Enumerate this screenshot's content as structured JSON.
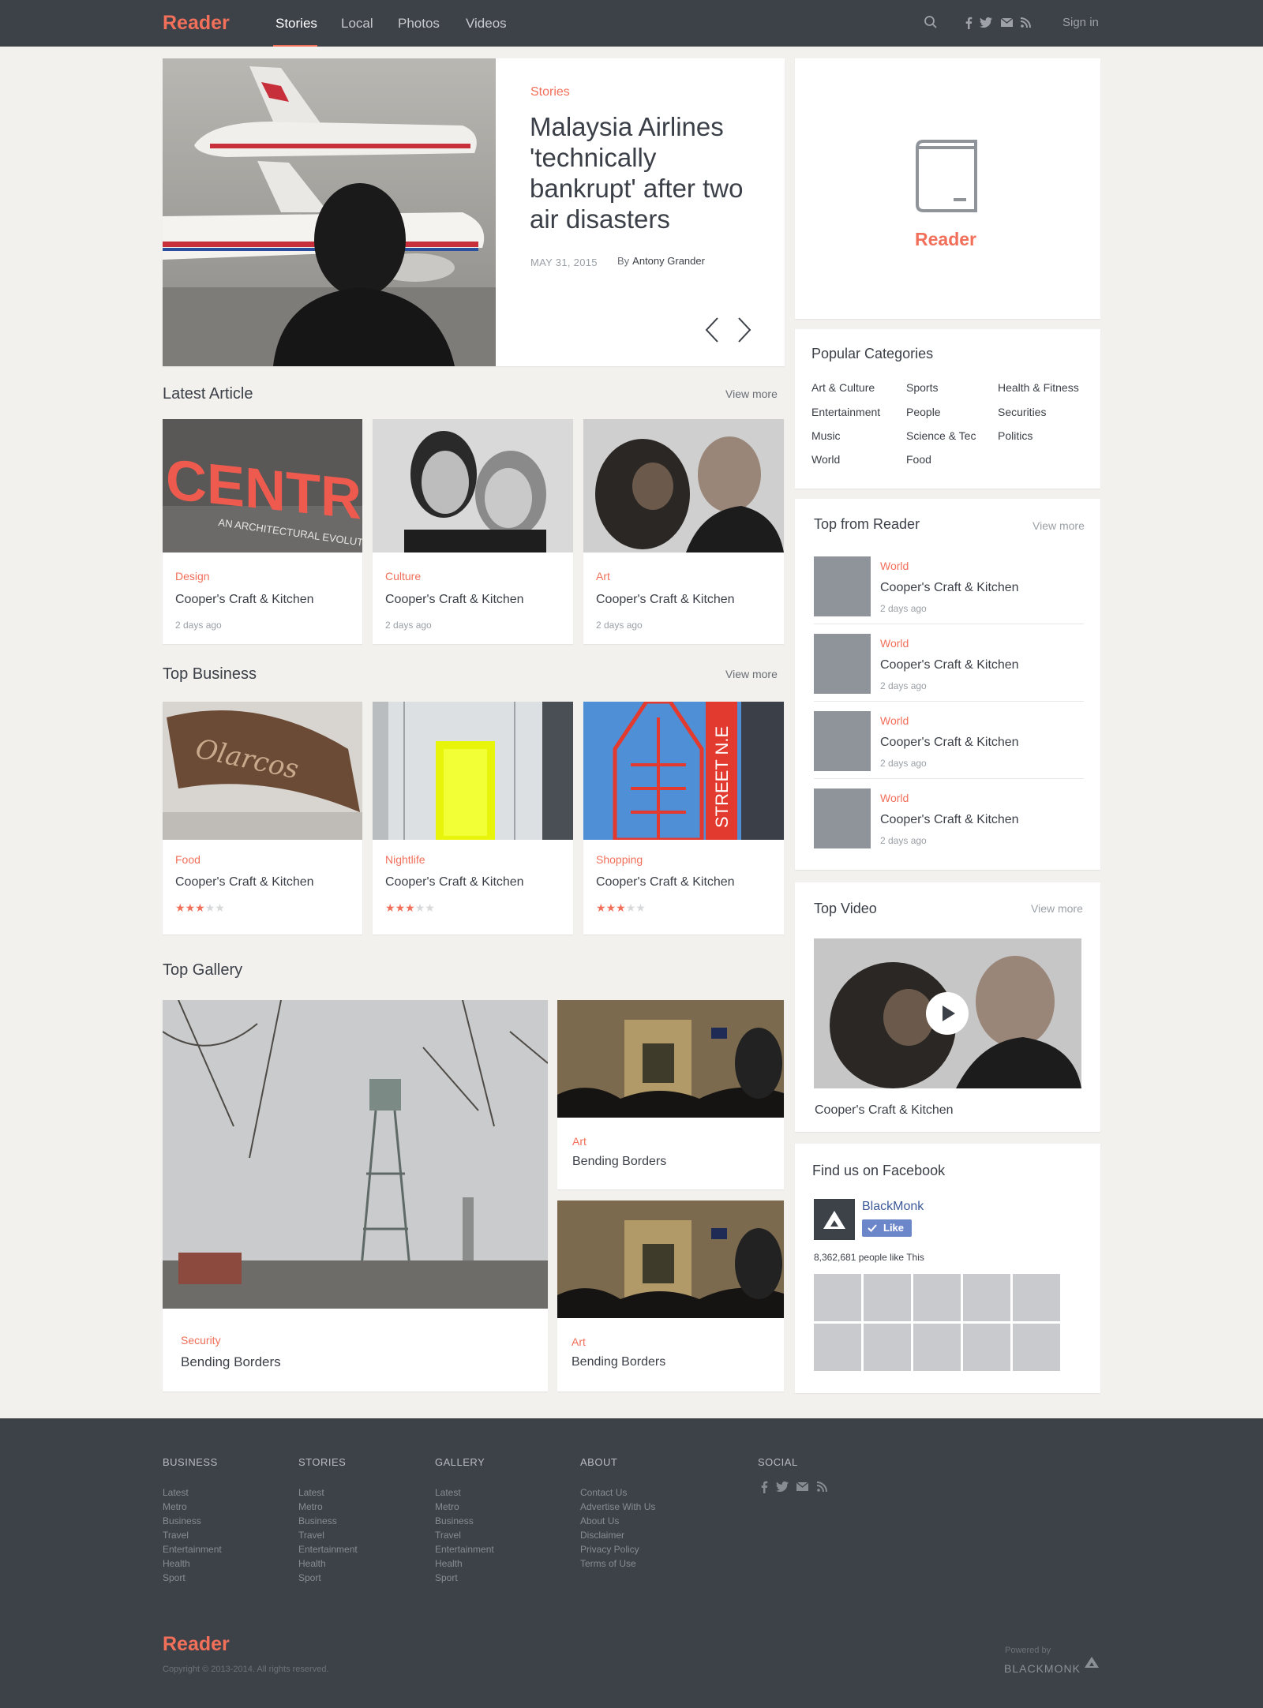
{
  "nav": {
    "logo": "Reader",
    "links": [
      "Stories",
      "Local",
      "Photos",
      "Videos"
    ],
    "signin": "Sign in"
  },
  "hero": {
    "category": "Stories",
    "title": "Malaysia Airlines 'technically bankrupt' after two air disasters",
    "date": "MAY 31, 2015",
    "by": "By",
    "author": "Antony Grander"
  },
  "brand_card": {
    "name": "Reader"
  },
  "latest": {
    "title": "Latest Article",
    "view_more": "View more",
    "items": [
      {
        "category": "Design",
        "title": "Cooper's Craft & Kitchen",
        "ago": "2 days ago"
      },
      {
        "category": "Culture",
        "title": "Cooper's Craft & Kitchen",
        "ago": "2 days ago"
      },
      {
        "category": "Art",
        "title": "Cooper's Craft & Kitchen",
        "ago": "2 days ago"
      }
    ]
  },
  "business": {
    "title": "Top Business",
    "view_more": "View more",
    "items": [
      {
        "category": "Food",
        "title": "Cooper's Craft & Kitchen",
        "rating": 3
      },
      {
        "category": "Nightlife",
        "title": "Cooper's Craft & Kitchen",
        "rating": 3
      },
      {
        "category": "Shopping",
        "title": "Cooper's Craft & Kitchen",
        "rating": 3
      }
    ]
  },
  "gallery": {
    "title": "Top Gallery",
    "items": [
      {
        "category": "Security",
        "title": "Bending Borders"
      },
      {
        "category": "Art",
        "title": "Bending Borders"
      },
      {
        "category": "Art",
        "title": "Bending Borders"
      }
    ]
  },
  "popular": {
    "title": "Popular Categories",
    "items": [
      "Art & Culture",
      "Sports",
      "Health & Fitness",
      "Entertainment",
      "People",
      "Securities",
      "Music",
      "Science & Tec",
      "Politics",
      "World",
      "Food"
    ]
  },
  "top_reader": {
    "title": "Top from Reader",
    "view_more": "View more",
    "items": [
      {
        "category": "World",
        "title": "Cooper's Craft & Kitchen",
        "ago": "2 days ago"
      },
      {
        "category": "World",
        "title": "Cooper's Craft & Kitchen",
        "ago": "2 days ago"
      },
      {
        "category": "World",
        "title": "Cooper's Craft & Kitchen",
        "ago": "2 days ago"
      },
      {
        "category": "World",
        "title": "Cooper's Craft & Kitchen",
        "ago": "2 days ago"
      }
    ]
  },
  "top_video": {
    "title": "Top Video",
    "view_more": "View more",
    "caption": "Cooper's Craft & Kitchen"
  },
  "facebook": {
    "title": "Find us on Facebook",
    "page": "BlackMonk",
    "like": "Like",
    "count": "8,362,681 people like This"
  },
  "footer": {
    "columns": [
      {
        "head": "BUSINESS",
        "links": [
          "Latest",
          "Metro",
          "Business",
          "Travel",
          "Entertainment",
          "Health",
          "Sport"
        ]
      },
      {
        "head": "STORIES",
        "links": [
          "Latest",
          "Metro",
          "Business",
          "Travel",
          "Entertainment",
          "Health",
          "Sport"
        ]
      },
      {
        "head": "GALLERY",
        "links": [
          "Latest",
          "Metro",
          "Business",
          "Travel",
          "Entertainment",
          "Health",
          "Sport"
        ]
      },
      {
        "head": "ABOUT",
        "links": [
          "Contact Us",
          "Advertise With Us",
          "About Us",
          "Disclaimer",
          "Privacy Policy",
          "Terms of Use"
        ]
      },
      {
        "head": "SOCIAL",
        "links": []
      }
    ],
    "logo": "Reader",
    "copyright": "Copyright © 2013-2014. All rights reserved.",
    "powered": "Powered by",
    "brand": "BLACKMONK"
  },
  "colors": {
    "accent": "#f26f5a",
    "nav_bg": "#3d4249",
    "page_bg": "#f2f1ee",
    "like_btn": "#6b86c9"
  },
  "icons": [
    "search-icon",
    "facebook-icon",
    "twitter-icon",
    "mail-icon",
    "rss-icon",
    "book-icon",
    "chevron-left-icon",
    "chevron-right-icon",
    "play-icon",
    "star-icon",
    "check-icon"
  ]
}
